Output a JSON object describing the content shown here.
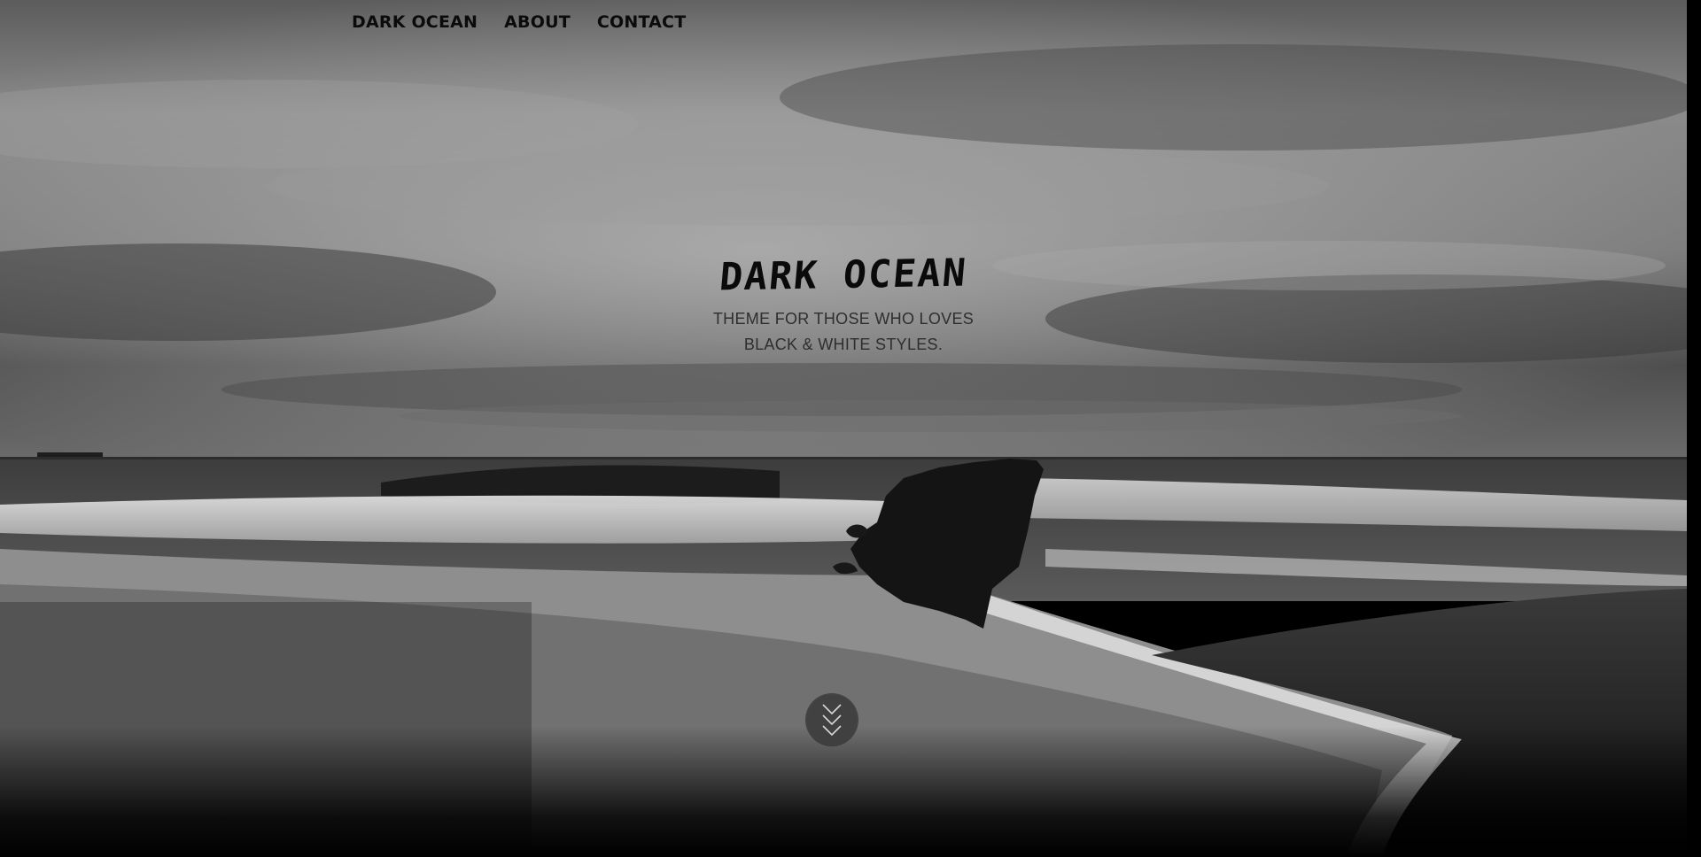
{
  "nav": {
    "items": [
      {
        "label": "DARK OCEAN"
      },
      {
        "label": "ABOUT"
      },
      {
        "label": "CONTACT"
      }
    ]
  },
  "hero": {
    "title": "DARK OCEAN",
    "tagline_line1": "THEME FOR THOSE WHO LOVES",
    "tagline_line2": "BLACK & WHITE STYLES.",
    "background": "ocean-beach-photo",
    "scroll_icon": "double-chevron-down-icon"
  },
  "colors": {
    "text": "#0a0a0a",
    "tagline": "#2e2e2e",
    "scroll_button": "#3c3c3c",
    "page_background": "#000000"
  }
}
